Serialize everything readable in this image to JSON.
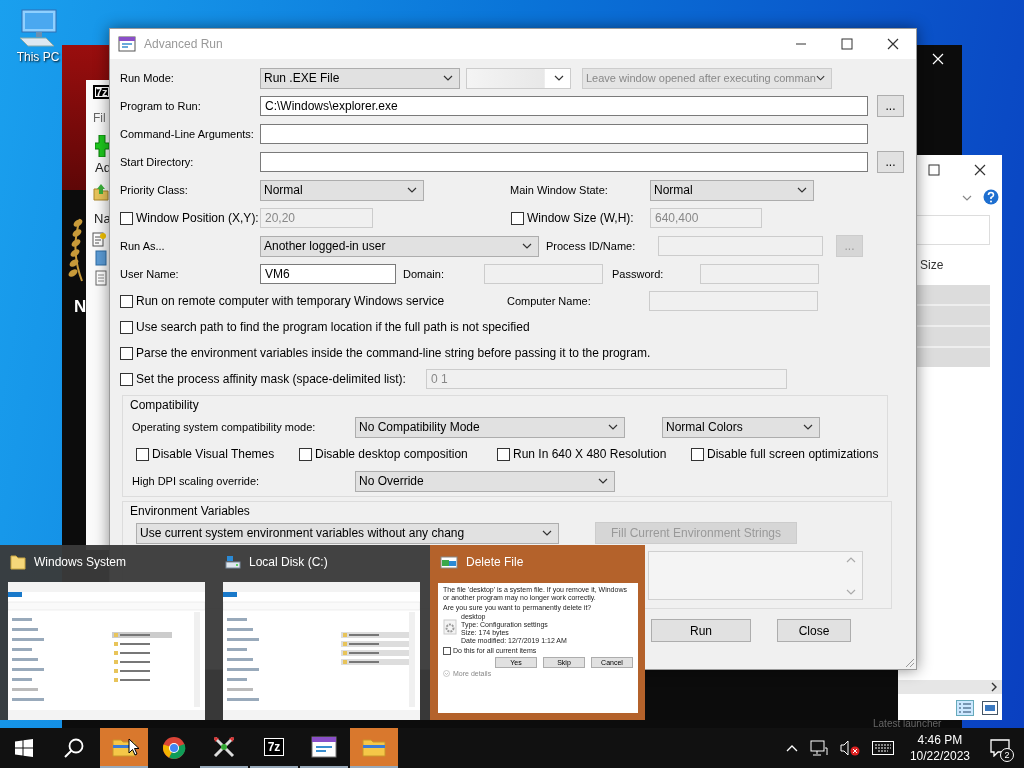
{
  "desktop_icons": [
    {
      "label": "This PC"
    }
  ],
  "background_window": {
    "text": "N",
    "footer": "Latest launcher"
  },
  "archiver_window": {
    "logo": "7z",
    "menu": "Fil",
    "toolbar_label": "Ad",
    "column_header": "Na"
  },
  "explorer_window": {
    "column_header": "Size"
  },
  "dialog": {
    "title": "Advanced Run",
    "run_mode": {
      "label": "Run Mode:",
      "value": "Run .EXE File",
      "console_option": {
        "value": "Leave window opened after executing comman",
        "disabled": true
      }
    },
    "program": {
      "label": "Program to Run:",
      "value": "C:\\Windows\\explorer.exe",
      "browse": "..."
    },
    "arguments": {
      "label": "Command-Line Arguments:"
    },
    "start_directory": {
      "label": "Start Directory:",
      "browse": "..."
    },
    "priority": {
      "label": "Priority Class:",
      "value": "Normal"
    },
    "main_window_state": {
      "label": "Main Window State:",
      "value": "Normal"
    },
    "window_position": {
      "label": "Window Position (X,Y):",
      "checked": false,
      "value": "20,20",
      "disabled": true
    },
    "window_size": {
      "label": "Window Size (W,H):",
      "checked": false,
      "value": "640,400",
      "disabled": true
    },
    "run_as": {
      "label": "Run As...",
      "value": "Another logged-in user"
    },
    "process": {
      "label": "Process ID/Name:",
      "browse": "...",
      "disabled": true
    },
    "user_name": {
      "label": "User Name:",
      "value": "VM6"
    },
    "domain": {
      "label": "Domain:",
      "disabled": true
    },
    "password": {
      "label": "Password:",
      "disabled": true
    },
    "options": [
      {
        "label": "Run on remote computer with temporary Windows service",
        "checked": false
      },
      {
        "label": "Use search path to find the program location if the full path is not specified",
        "checked": false
      },
      {
        "label": "Parse the environment variables inside the command-line string before passing it to the program.",
        "checked": false
      },
      {
        "label": "Set the process affinity mask (space-delimited list):",
        "checked": false
      }
    ],
    "computer_name": {
      "label": "Computer Name:",
      "disabled": true
    },
    "affinity_mask": {
      "value": "0 1",
      "disabled": true
    },
    "compatibility": {
      "title": "Compatibility",
      "os_label": "Operating system compatibility mode:",
      "os_mode": "No Compatibility Mode",
      "color_mode": "Normal Colors",
      "options": [
        {
          "label": "Disable Visual Themes",
          "checked": false
        },
        {
          "label": "Disable desktop composition",
          "checked": false
        },
        {
          "label": "Run In 640 X 480 Resolution",
          "checked": false
        },
        {
          "label": "Disable full screen optimizations",
          "checked": false
        }
      ],
      "dpi_label": "High DPI scaling override:",
      "dpi_mode": "No Override"
    },
    "environment": {
      "title": "Environment Variables",
      "mode": "Use current system environment variables without any chang",
      "fill_button": {
        "label": "Fill Current Environment Strings",
        "disabled": true
      }
    },
    "buttons": [
      "Run",
      "Close"
    ]
  },
  "task_previews": [
    {
      "title": "Windows System",
      "kind": "folder",
      "selected": false
    },
    {
      "title": "Local Disk (C:)",
      "kind": "drive",
      "selected": false
    },
    {
      "title": "Delete File",
      "kind": "dialog",
      "selected": true,
      "content": {
        "message": "The file 'desktop' is a system file. If you remove it, Windows or another program may no longer work correctly.",
        "question": "Are you sure you want to permanently delete it?",
        "file_details": [
          "desktop",
          "Type: Configuration settings",
          "Size: 174 bytes",
          "Date modified: 12/7/2019 1:12 AM"
        ],
        "apply_all": {
          "label": "Do this for all current items",
          "checked": false
        },
        "buttons": [
          "Yes",
          "Skip",
          "Cancel"
        ],
        "more": "More details"
      }
    }
  ],
  "taskbar": {
    "apps": [
      {
        "kind": "explorer",
        "flashing": true,
        "running": true
      },
      {
        "kind": "browser",
        "flashing": false,
        "running": false
      },
      {
        "kind": "tool",
        "flashing": false,
        "running": true
      },
      {
        "kind": "archiver",
        "label": "7z",
        "flashing": false,
        "running": true
      },
      {
        "kind": "runner",
        "flashing": false,
        "running": true
      },
      {
        "kind": "explorer",
        "flashing": true,
        "running": true
      }
    ],
    "time": "4:46 PM",
    "date": "10/22/2023",
    "notifications": "2"
  }
}
